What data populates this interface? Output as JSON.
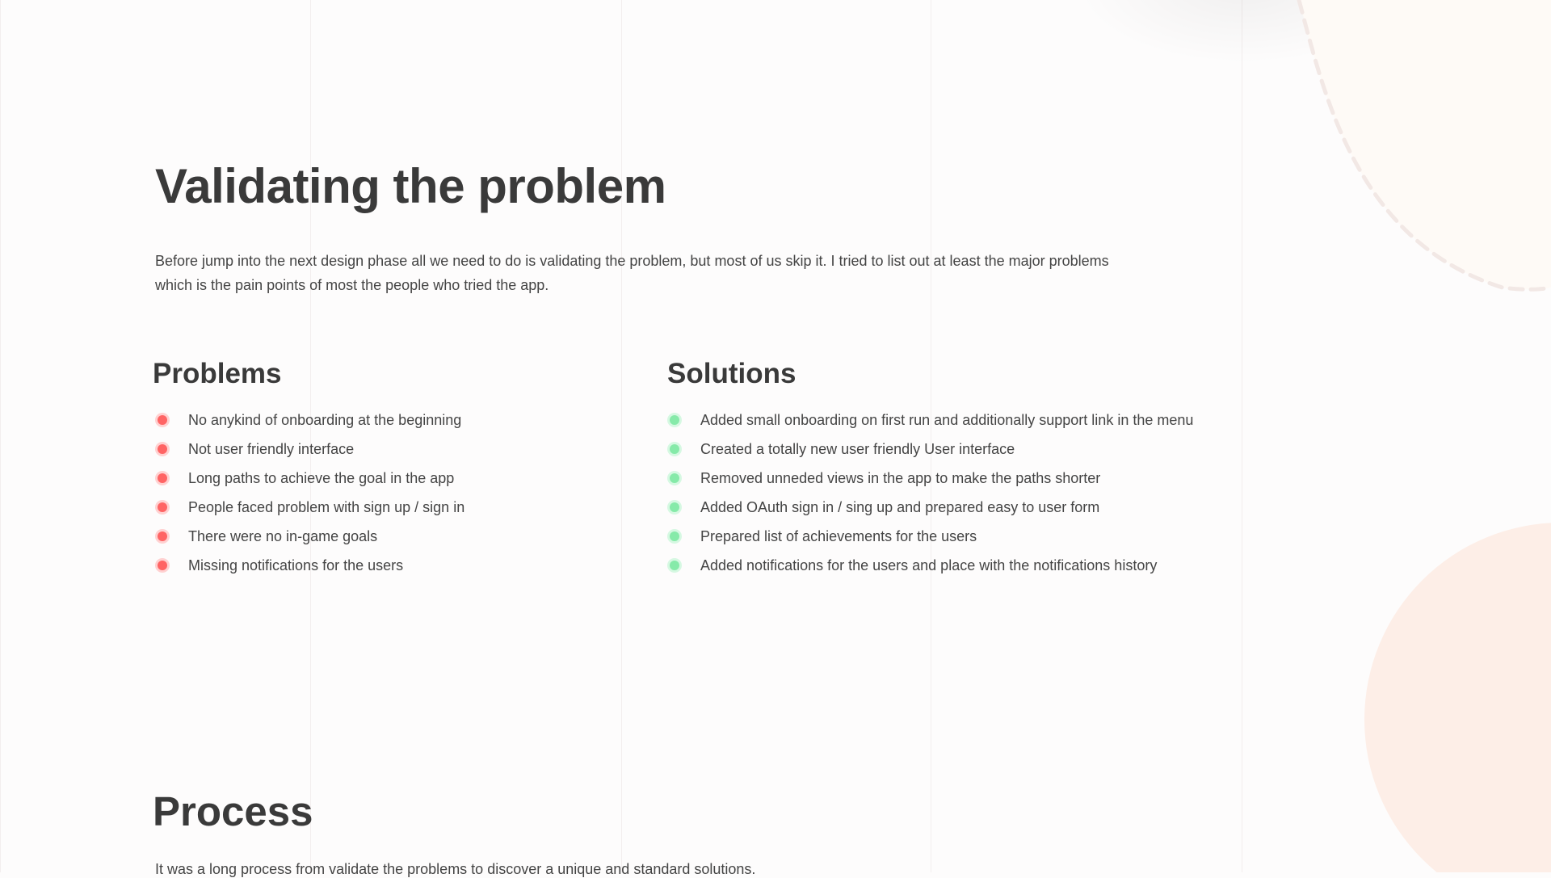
{
  "section": {
    "title": "Validating the problem",
    "intro": "Before jump into the next design phase all we need to do is validating the problem, but most of us skip it. I tried to list out at least the major problems which is the pain points of most the people who tried the app."
  },
  "problems": {
    "heading": "Problems",
    "bullet_color": "#ff6464",
    "items": [
      "No anykind of onboarding at the beginning",
      "Not user friendly interface",
      "Long paths to achieve the goal in the app",
      "People faced problem with sign up / sign in",
      "There were no in-game goals",
      "Missing notifications for the users"
    ]
  },
  "solutions": {
    "heading": "Solutions",
    "bullet_color": "#86eaa9",
    "items": [
      "Added small onboarding on first run and additionally support link in the menu",
      "Created a totally new user friendly User interface",
      "Removed unneded views in the app to make the paths shorter",
      "Added OAuth sign in / sing up and prepared easy to user form",
      "Prepared list of achievements for the users",
      "Added notifications for the users and place with the notifications history"
    ]
  },
  "process": {
    "title": "Process",
    "intro": "It was a long process from validate the problems to discover a unique and standard solutions."
  },
  "colors": {
    "background": "#fdfcfc",
    "accent_circle": "#fdeee7",
    "text": "#3c3c3c"
  }
}
